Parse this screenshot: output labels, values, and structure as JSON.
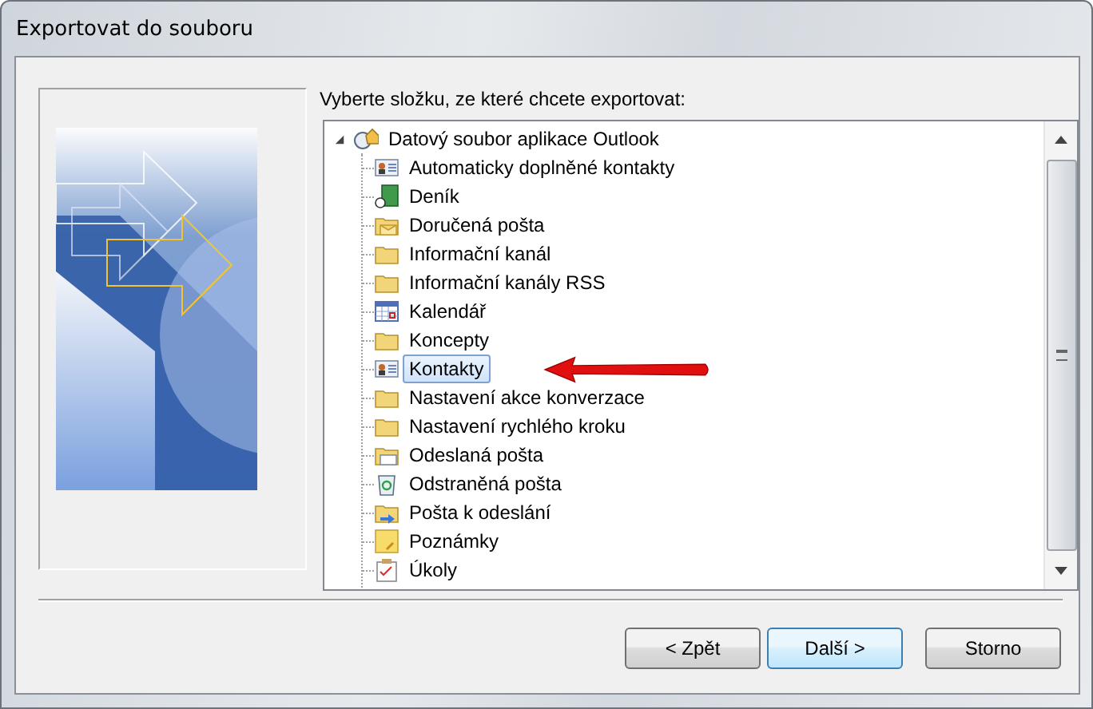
{
  "window": {
    "title": "Exportovat do souboru"
  },
  "instruction": "Vyberte složku, ze které chcete exportovat:",
  "tree": {
    "label": "Datový soubor aplikace Outlook",
    "kind": "datafile",
    "expanded": true,
    "selected": false,
    "children": [
      {
        "label": "Automaticky doplněné kontakty",
        "kind": "contacts",
        "selected": false
      },
      {
        "label": "Deník",
        "kind": "journal",
        "selected": false
      },
      {
        "label": "Doručená pošta",
        "kind": "inbox",
        "selected": false
      },
      {
        "label": "Informační kanál",
        "kind": "folder",
        "selected": false
      },
      {
        "label": "Informační kanály RSS",
        "kind": "folder",
        "selected": false
      },
      {
        "label": "Kalendář",
        "kind": "calendar",
        "selected": false
      },
      {
        "label": "Koncepty",
        "kind": "folder",
        "selected": false
      },
      {
        "label": "Kontakty",
        "kind": "contacts",
        "selected": true
      },
      {
        "label": "Nastavení akce konverzace",
        "kind": "folder",
        "selected": false
      },
      {
        "label": "Nastavení rychlého kroku",
        "kind": "folder",
        "selected": false
      },
      {
        "label": "Odeslaná pošta",
        "kind": "sent",
        "selected": false
      },
      {
        "label": "Odstraněná pošta",
        "kind": "deleted",
        "selected": false
      },
      {
        "label": "Pošta k odeslání",
        "kind": "outbox",
        "selected": false
      },
      {
        "label": "Poznámky",
        "kind": "notes",
        "selected": false
      },
      {
        "label": "Úkoly",
        "kind": "tasks",
        "selected": false
      }
    ]
  },
  "buttons": [
    {
      "label": "< Zpět",
      "kind": "back",
      "focused": false
    },
    {
      "label": "Další >",
      "kind": "next",
      "focused": true
    },
    {
      "label": "Storno",
      "kind": "cancel",
      "focused": false
    }
  ]
}
